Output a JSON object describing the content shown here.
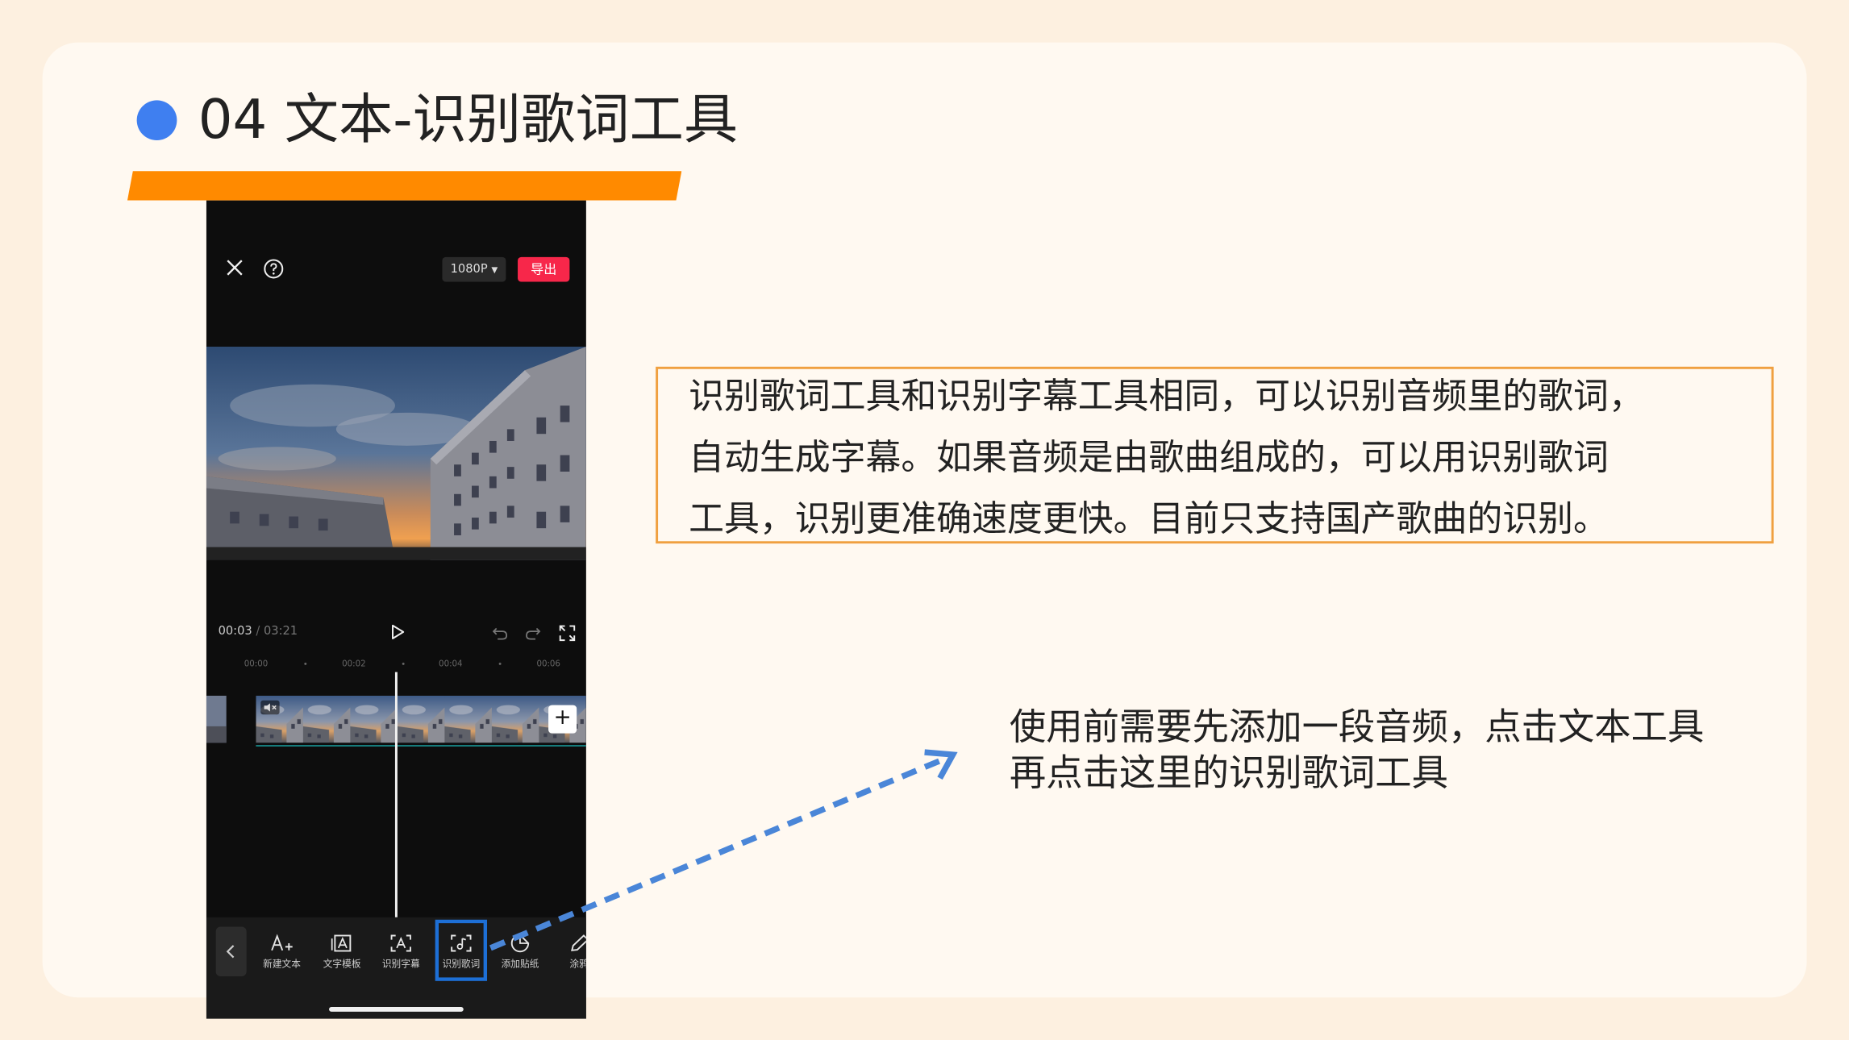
{
  "slide": {
    "title": "04 文本-识别歌词工具",
    "description_lines": [
      "识别歌词工具和识别字幕工具相同，可以识别音频里的歌词，",
      "自动生成字幕。如果音频是由歌曲组成的，可以用识别歌词",
      "工具，识别更准确速度更快。目前只支持国产歌曲的识别。"
    ],
    "note_lines": [
      "使用前需要先添加一段音频，点击文本工具",
      "再点击这里的识别歌词工具"
    ]
  },
  "editor": {
    "resolution": "1080P",
    "export_label": "导出",
    "current_time": "00:03",
    "time_separator": " / ",
    "total_time": "03:21",
    "ruler": [
      "00:00",
      "00:02",
      "00:04",
      "00:06"
    ],
    "add_clip_label": "+",
    "tools": [
      {
        "label": "新建文本",
        "icon": "add-text-icon"
      },
      {
        "label": "文字模板",
        "icon": "text-template-icon"
      },
      {
        "label": "识别字幕",
        "icon": "recognize-subtitle-icon"
      },
      {
        "label": "识别歌词",
        "icon": "recognize-lyrics-icon"
      },
      {
        "label": "添加贴纸",
        "icon": "sticker-icon"
      },
      {
        "label": "涂鸦",
        "icon": "doodle-icon"
      }
    ],
    "highlighted_tool": "识别歌词"
  },
  "colors": {
    "page_bg": "#fdf0e0",
    "card_bg": "#fff9f1",
    "bullet": "#3f7ff0",
    "title_underline": "#ff8a00",
    "box_border": "#f0a040",
    "arrow": "#4a86d8",
    "export_button": "#f7274a",
    "highlight_box": "#1d6fd6"
  }
}
